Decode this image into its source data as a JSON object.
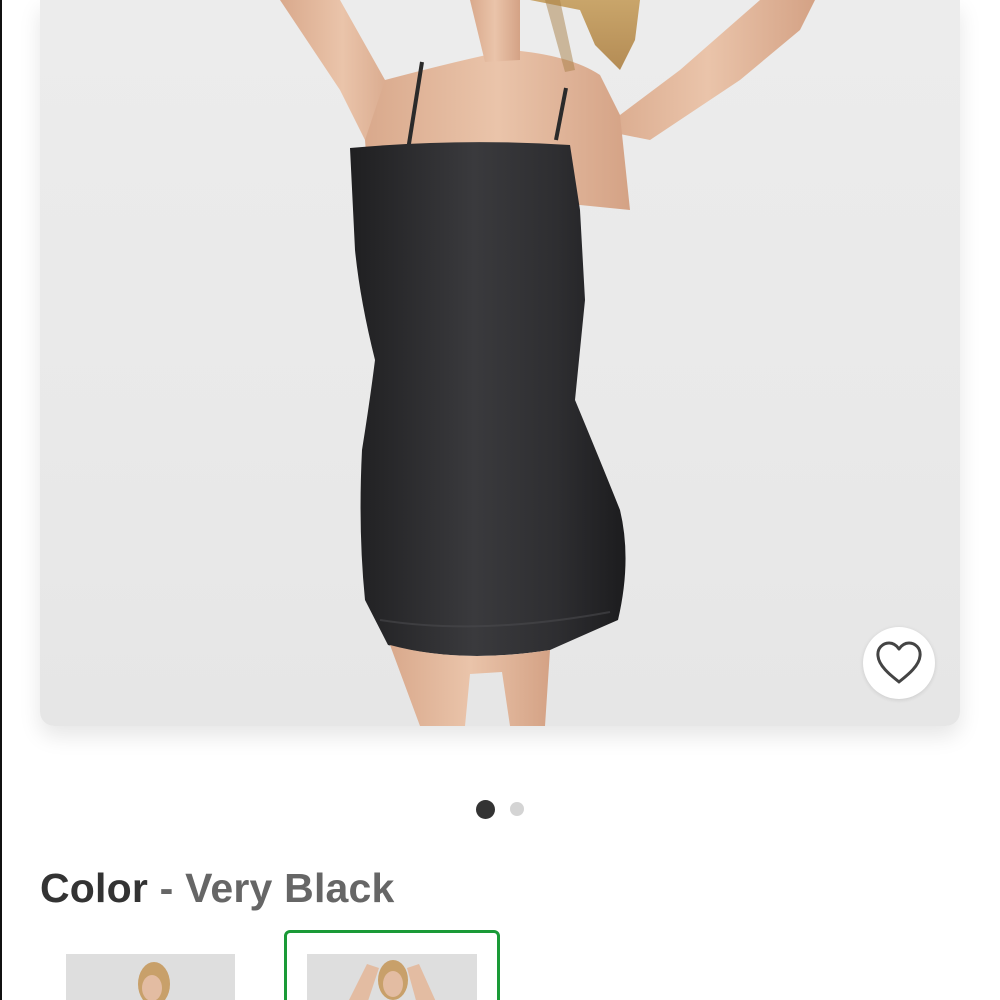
{
  "product": {
    "image_alt": "Woman wearing a black strapless-style slip dress",
    "favorite_icon": "heart-outline-icon"
  },
  "carousel": {
    "total": 2,
    "active_index": 0
  },
  "color_selector": {
    "label": "Color",
    "separator": "-",
    "selected_value": "Very Black",
    "swatches": [
      {
        "name": "swatch-option-1",
        "selected": false
      },
      {
        "name": "swatch-option-2",
        "selected": true
      }
    ]
  },
  "colors": {
    "selected_border": "#1a9a37",
    "active_dot": "#333333",
    "inactive_dot": "#d4d4d4",
    "dress": "#2b2b2d",
    "skin": "#e2b89c"
  }
}
